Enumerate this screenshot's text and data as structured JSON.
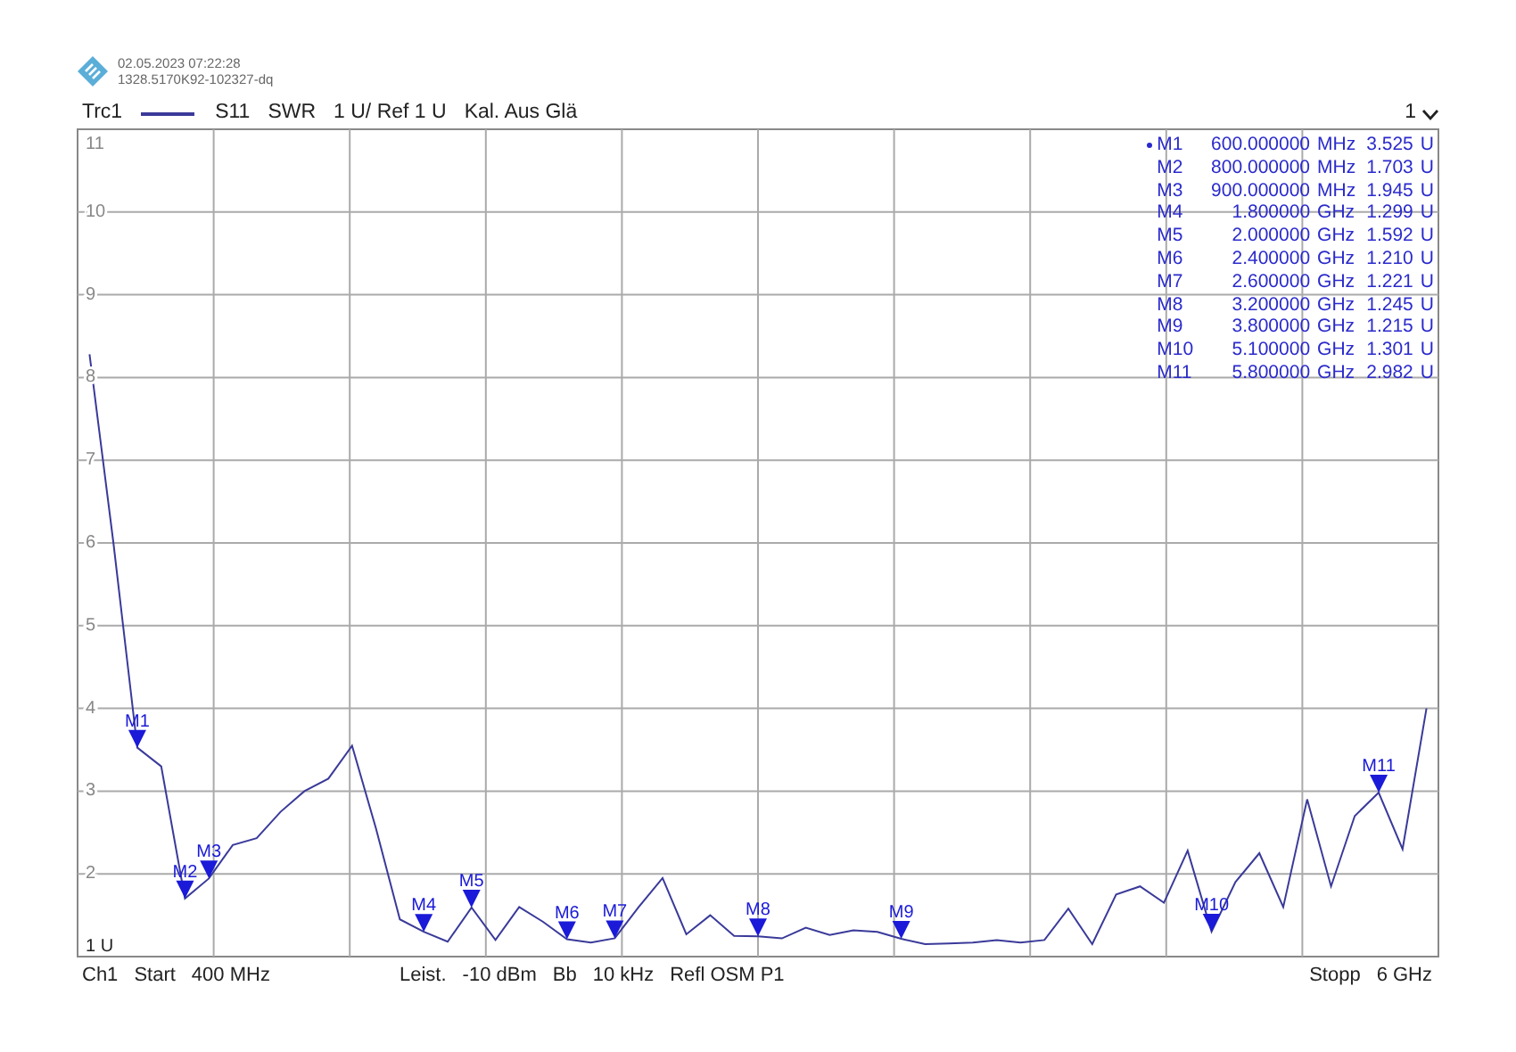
{
  "header": {
    "timestamp": "02.05.2023 07:22:28",
    "device_id": "1328.5170K92-102327-dq"
  },
  "trace_bar": {
    "parameter": "S11",
    "format": "SWR",
    "scale": "1 U/ Ref 1 U",
    "calibration": "Kal. Aus Glä",
    "window_number": "1"
  },
  "markers": [
    {
      "name": "M1",
      "frequency": "600.000000",
      "unit": "MHz",
      "value": "3.525",
      "value_unit": "U",
      "active": true
    },
    {
      "name": "M2",
      "frequency": "800.000000",
      "unit": "MHz",
      "value": "1.703",
      "value_unit": "U",
      "active": false
    },
    {
      "name": "M3",
      "frequency": "900.000000",
      "unit": "MHz",
      "value": "1.945",
      "value_unit": "U",
      "active": false
    },
    {
      "name": "M4",
      "frequency": "1.800000",
      "unit": "GHz",
      "value": "1.299",
      "value_unit": "U",
      "active": false
    },
    {
      "name": "M5",
      "frequency": "2.000000",
      "unit": "GHz",
      "value": "1.592",
      "value_unit": "U",
      "active": false
    },
    {
      "name": "M6",
      "frequency": "2.400000",
      "unit": "GHz",
      "value": "1.210",
      "value_unit": "U",
      "active": false
    },
    {
      "name": "M7",
      "frequency": "2.600000",
      "unit": "GHz",
      "value": "1.221",
      "value_unit": "U",
      "active": false
    },
    {
      "name": "M8",
      "frequency": "3.200000",
      "unit": "GHz",
      "value": "1.245",
      "value_unit": "U",
      "active": false
    },
    {
      "name": "M9",
      "frequency": "3.800000",
      "unit": "GHz",
      "value": "1.215",
      "value_unit": "U",
      "active": false
    },
    {
      "name": "M10",
      "frequency": "5.100000",
      "unit": "GHz",
      "value": "1.301",
      "value_unit": "U",
      "active": false
    },
    {
      "name": "M11",
      "frequency": "5.800000",
      "unit": "GHz",
      "value": "2.982",
      "value_unit": "U",
      "active": false
    }
  ],
  "chart_data": {
    "type": "line",
    "ylim": [
      1,
      11
    ],
    "grid": true,
    "yticks": [
      {
        "value": 1,
        "label": "1 U"
      },
      2,
      3,
      4,
      5,
      6,
      7,
      8,
      9,
      10,
      11
    ],
    "categories": [
      null,
      null,
      null,
      null,
      null,
      null,
      null,
      null,
      null,
      null,
      null,
      null,
      null,
      null,
      null,
      null,
      null,
      null,
      null,
      null,
      null,
      null,
      null,
      null,
      null,
      null,
      null,
      null,
      null,
      null,
      null,
      null,
      null,
      null,
      null,
      null,
      null,
      null,
      null,
      null,
      null,
      null,
      null,
      null,
      null,
      null,
      null,
      null,
      null,
      null,
      null,
      null,
      null,
      null,
      null,
      null,
      null
    ],
    "series": [
      {
        "name": "Trc1",
        "color": "#3a3a9a",
        "values": [
          8.28,
          6.0,
          3.525,
          3.3,
          1.703,
          1.945,
          2.35,
          2.43,
          2.75,
          3.0,
          3.15,
          3.55,
          2.55,
          1.45,
          1.299,
          1.18,
          1.592,
          1.2,
          1.6,
          1.42,
          1.21,
          1.17,
          1.221,
          1.6,
          1.95,
          1.27,
          1.5,
          1.25,
          1.245,
          1.22,
          1.35,
          1.26,
          1.32,
          1.3,
          1.215,
          1.15,
          1.16,
          1.17,
          1.2,
          1.17,
          1.2,
          1.58,
          1.15,
          1.75,
          1.85,
          1.65,
          2.28,
          1.301,
          1.9,
          2.25,
          1.6,
          2.9,
          1.85,
          2.7,
          2.982,
          2.3,
          4.0
        ]
      }
    ],
    "annotations": [
      {
        "text": "M1",
        "y": 3.525
      },
      {
        "text": "M2",
        "y": 1.703
      },
      {
        "text": "M3",
        "y": 1.945
      },
      {
        "text": "M4",
        "y": 1.299
      },
      {
        "text": "M5",
        "y": 1.592
      },
      {
        "text": "M6",
        "y": 1.21
      },
      {
        "text": "M7",
        "y": 1.221
      },
      {
        "text": "M8",
        "y": 1.245
      },
      {
        "text": "M9",
        "y": 1.215
      },
      {
        "text": "M10",
        "y": 1.301
      },
      {
        "text": "M11",
        "y": 2.982
      }
    ]
  },
  "footer": {
    "channel": "Ch1",
    "start_label": "Start",
    "start_value": "400 MHz",
    "power_label": "Leist.",
    "power_value": "-10 dBm",
    "bandwidth_label": "Bb",
    "bandwidth_value": "10 kHz",
    "calibration": "Refl OSM P1",
    "stop_label": "Stopp",
    "stop_value": "6 GHz"
  }
}
